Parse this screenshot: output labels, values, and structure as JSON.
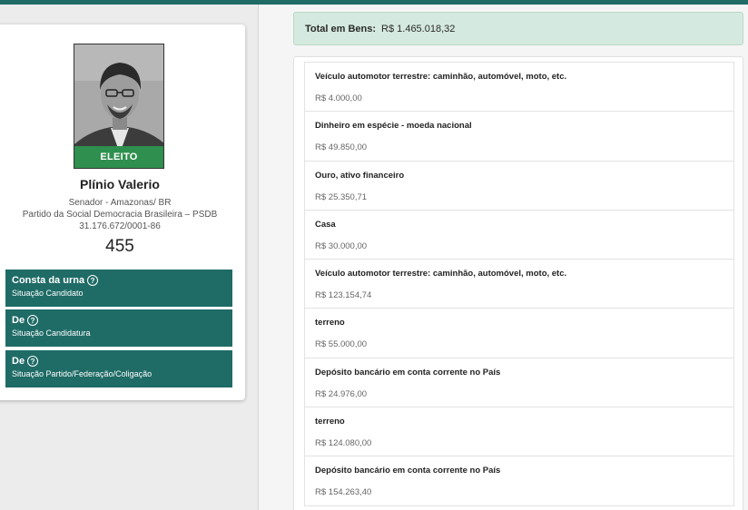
{
  "candidate": {
    "status_tag": "ELEITO",
    "name": "Plínio Valerio",
    "office": "Senador - Amazonas/ BR",
    "party": "Partido da Social Democracia Brasileira – PSDB",
    "cnpj": "31.176.672/0001-86",
    "number": "455"
  },
  "statuses": [
    {
      "value": "Consta da urna",
      "label": "Situação Candidato"
    },
    {
      "value": "De",
      "label": "Situação Candidatura"
    },
    {
      "value": "De",
      "label": "Situação Partido/Federação/Coligação"
    }
  ],
  "assets": {
    "total_label": "Total em Bens:",
    "total_value": "R$ 1.465.018,32",
    "items": [
      {
        "desc": "Veículo automotor terrestre: caminhão, automóvel, moto, etc.",
        "value": "R$ 4.000,00"
      },
      {
        "desc": "Dinheiro em espécie - moeda nacional",
        "value": "R$ 49.850,00"
      },
      {
        "desc": "Ouro, ativo financeiro",
        "value": "R$ 25.350,71"
      },
      {
        "desc": "Casa",
        "value": "R$ 30.000,00"
      },
      {
        "desc": "Veículo automotor terrestre: caminhão, automóvel, moto, etc.",
        "value": "R$ 123.154,74"
      },
      {
        "desc": "terreno",
        "value": "R$ 55.000,00"
      },
      {
        "desc": "Depósito bancário em conta corrente no País",
        "value": "R$ 24.976,00"
      },
      {
        "desc": "terreno",
        "value": "R$ 124.080,00"
      },
      {
        "desc": "Depósito bancário em conta corrente no País",
        "value": "R$ 154.263,40"
      }
    ]
  },
  "icons": {
    "help": "help-circle-icon"
  },
  "colors": {
    "primary": "#1f6b66",
    "elected": "#2f8f4e",
    "total_bg": "#d4e9df"
  }
}
